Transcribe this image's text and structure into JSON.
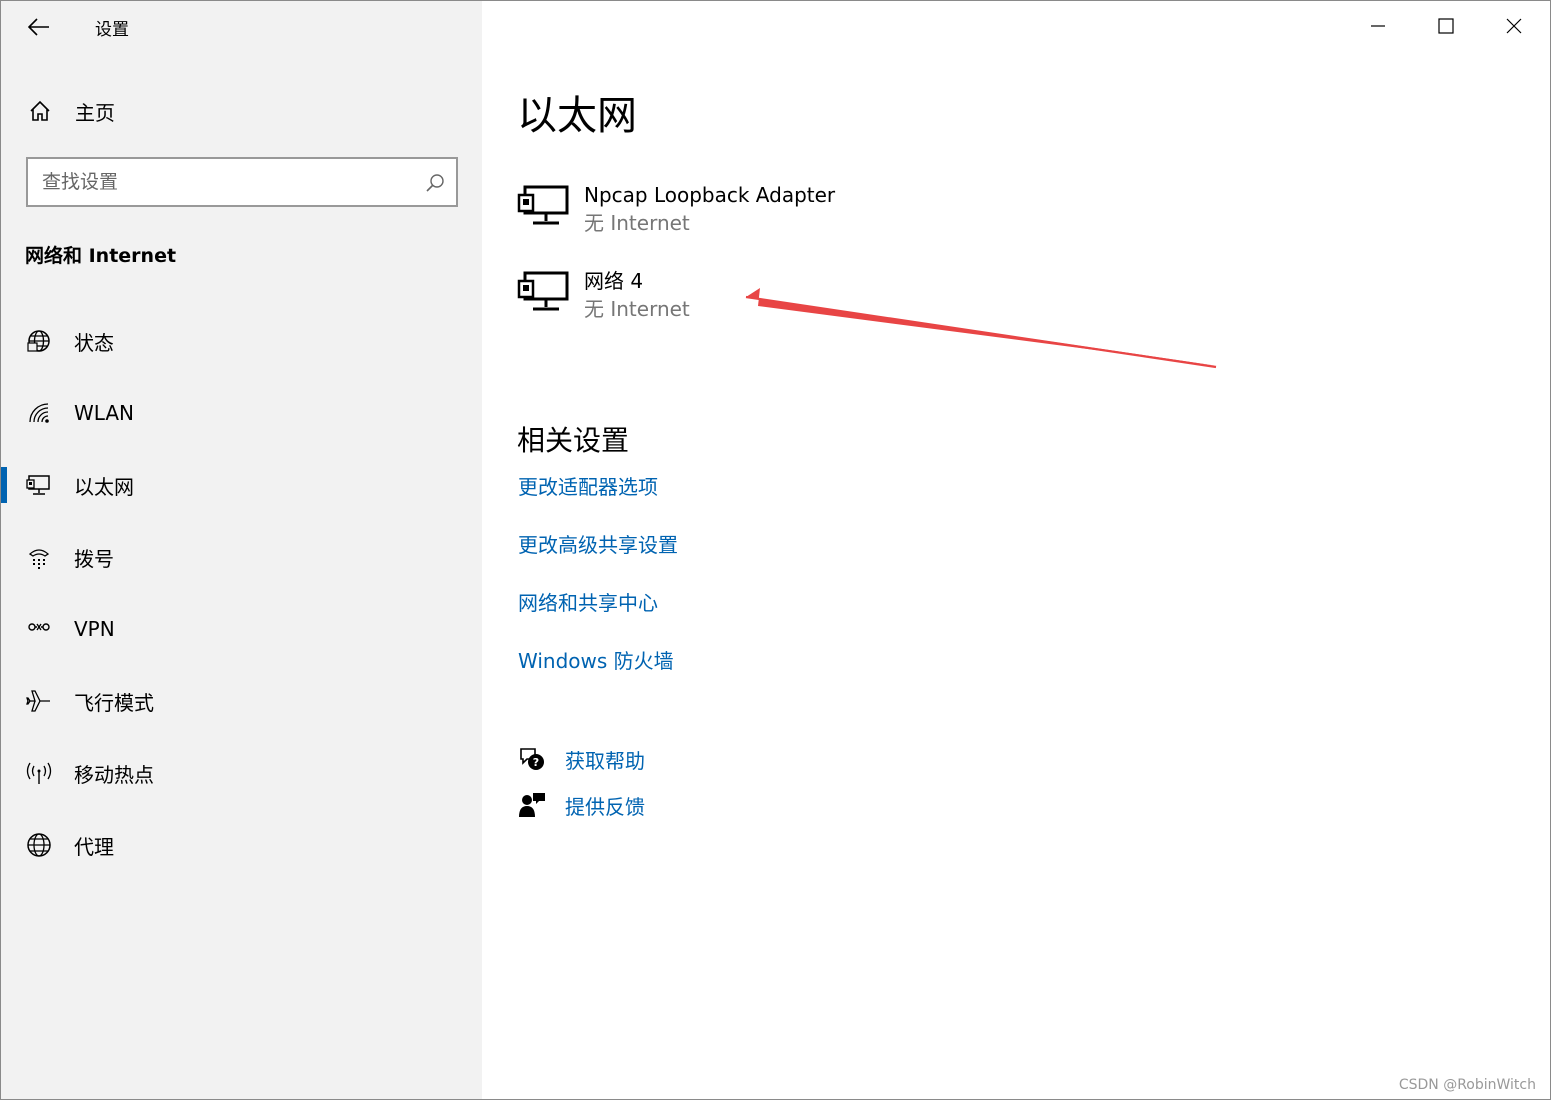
{
  "window": {
    "title": "设置",
    "controls": [
      "minimize",
      "maximize",
      "close"
    ]
  },
  "sidebar": {
    "home_label": "主页",
    "search_placeholder": "查找设置",
    "section_title": "网络和 Internet",
    "items": [
      {
        "label": "状态",
        "icon": "globe-status-icon",
        "active": false
      },
      {
        "label": "WLAN",
        "icon": "wifi-icon",
        "active": false
      },
      {
        "label": "以太网",
        "icon": "ethernet-icon",
        "active": true
      },
      {
        "label": "拨号",
        "icon": "dialup-icon",
        "active": false
      },
      {
        "label": "VPN",
        "icon": "vpn-icon",
        "active": false
      },
      {
        "label": "飞行模式",
        "icon": "airplane-icon",
        "active": false
      },
      {
        "label": "移动热点",
        "icon": "hotspot-icon",
        "active": false
      },
      {
        "label": "代理",
        "icon": "globe-proxy-icon",
        "active": false
      }
    ]
  },
  "main": {
    "title": "以太网",
    "adapters": [
      {
        "name": "Npcap Loopback Adapter",
        "status": "无 Internet"
      },
      {
        "name": "网络 4",
        "status": "无 Internet"
      }
    ],
    "related_title": "相关设置",
    "related_links": [
      "更改适配器选项",
      "更改高级共享设置",
      "网络和共享中心",
      "Windows 防火墙"
    ],
    "help": [
      {
        "label": "获取帮助",
        "icon": "help-chat-icon"
      },
      {
        "label": "提供反馈",
        "icon": "feedback-icon"
      }
    ]
  },
  "colors": {
    "accent": "#0063b1",
    "sidebar_bg": "#f2f2f2",
    "annotation_arrow": "#e84545",
    "muted_text": "#767676"
  },
  "watermark": "CSDN @RobinWitch"
}
